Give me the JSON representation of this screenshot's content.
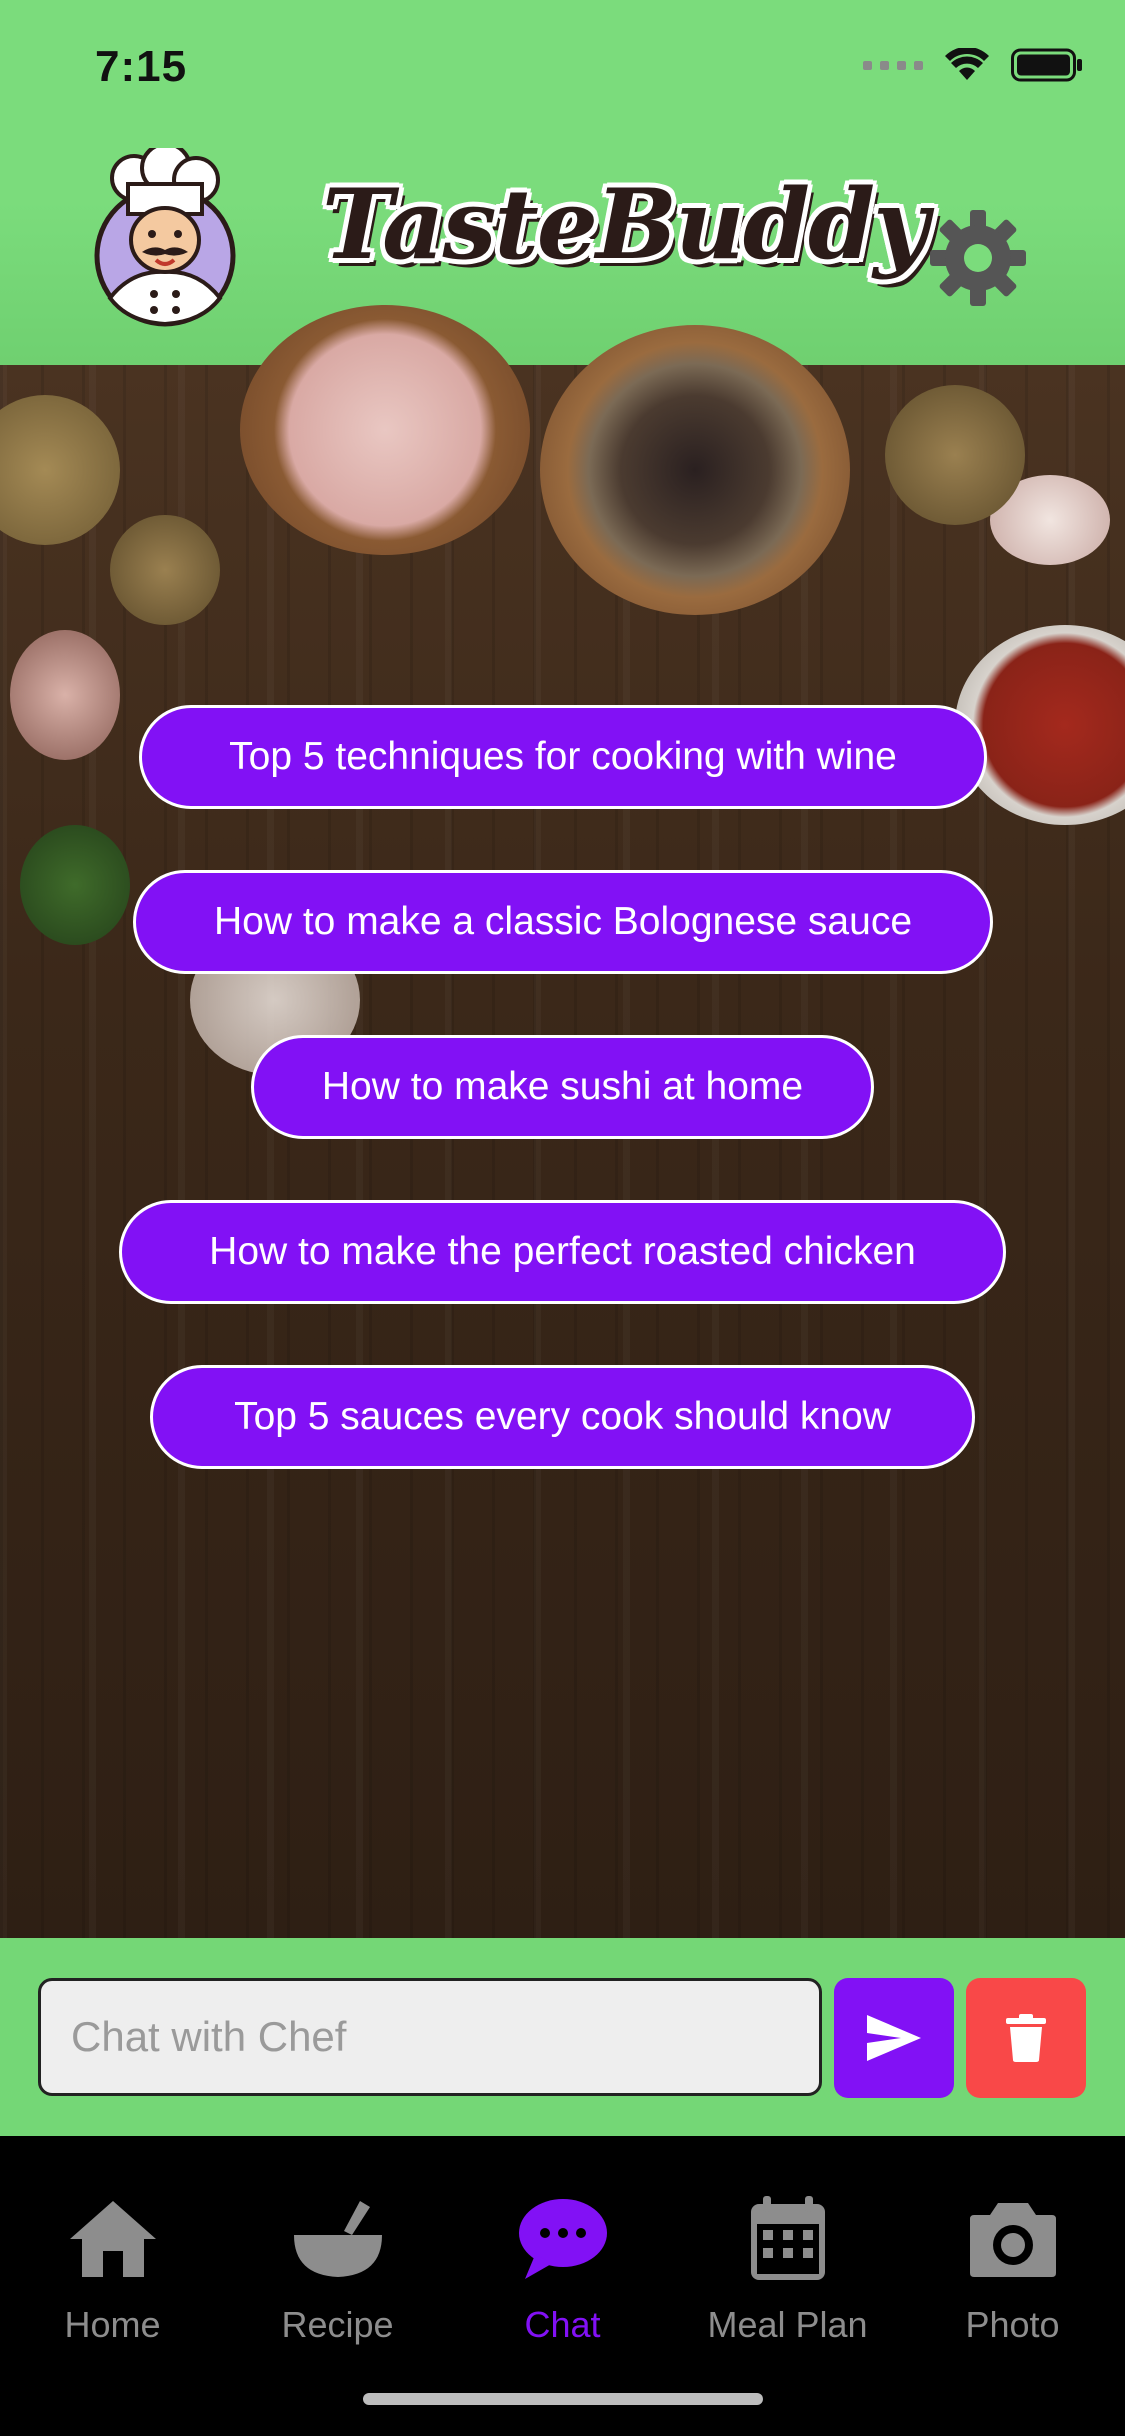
{
  "status_bar": {
    "time": "7:15"
  },
  "header": {
    "app_title": "TasteBuddy",
    "avatar_icon": "chef-avatar-icon",
    "settings_icon": "gear-icon",
    "background_color": "#7bdc7c"
  },
  "suggestions": [
    {
      "label": "Top 5 techniques for cooking with wine"
    },
    {
      "label": "How to make a classic Bolognese sauce"
    },
    {
      "label": "How to make sushi at home"
    },
    {
      "label": "How to make the perfect roasted chicken"
    },
    {
      "label": "Top 5 sauces every cook should know"
    }
  ],
  "chat": {
    "placeholder": "Chat with Chef",
    "value": "",
    "send_icon": "send-icon",
    "delete_icon": "trash-icon"
  },
  "tabs": [
    {
      "label": "Home",
      "icon": "home-icon",
      "active": false
    },
    {
      "label": "Recipe",
      "icon": "bowl-icon",
      "active": false
    },
    {
      "label": "Chat",
      "icon": "chat-bubble-icon",
      "active": true
    },
    {
      "label": "Meal Plan",
      "icon": "calendar-icon",
      "active": false
    },
    {
      "label": "Photo",
      "icon": "camera-icon",
      "active": false
    }
  ],
  "colors": {
    "accent": "#8211f5",
    "delete": "#f94848",
    "inactive_tab": "#8d8d8d"
  }
}
